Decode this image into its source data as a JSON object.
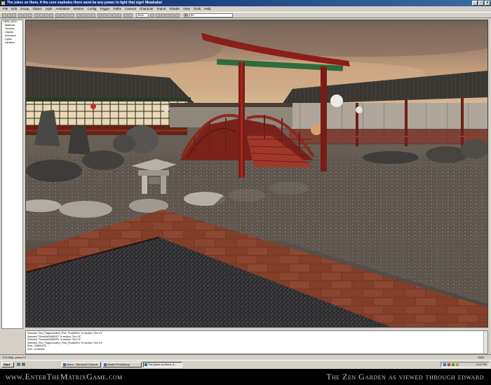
{
  "window": {
    "title": "The jokes on them, if the core explodes there wont be any power to light that sign! Mwahaha!"
  },
  "menu": [
    "File",
    "Edit",
    "Group",
    "Object",
    "Light",
    "Animation",
    "Section",
    "Config",
    "Trigger",
    "Paths",
    "Camera",
    "Character",
    "Import",
    "Shader",
    "View",
    "Tools",
    "Help"
  ],
  "toolbar": {
    "field1": "3000",
    "field2": "99"
  },
  "sidebar": {
    "items": [
      "NEW_WOV",
      "Materials",
      "Textures",
      "Objects",
      "Animation",
      "Lights",
      "Particles"
    ]
  },
  "console": {
    "lines": [
      "Selected \"Zen_PagesLantern_Pole_Pool80001\" in section \"Zen 01\"",
      "Selected \"StoneArt2A80012\" in section \"Zen 01\"",
      "Selected \"StoneArt2A80000\" in section \"Zen 01\"",
      "Selected \"Zen_PagesLantern_Pole_Pool80001\" in section \"Zen 01\"",
      "Size: 13660x135",
      "Size: 1126x165"
    ]
  },
  "status": {
    "help": "For Help, press F1",
    "right": "1509"
  },
  "taskbar": {
    "start": "Start",
    "tasks": [
      "Inbox - Microsoft Outlook",
      "Adobe Photoshop",
      "The jokes on them, if..."
    ],
    "clock": "3:22 PM"
  },
  "caption": {
    "left": "www.EnterTheMatrixGame.com",
    "right": "The Zen Garden as viewed through edward"
  },
  "colors": {
    "titlebar": "#0a246a",
    "face": "#d4d0c8",
    "torii_red": "#8c1e18",
    "torii_green": "#2f6b3c"
  }
}
